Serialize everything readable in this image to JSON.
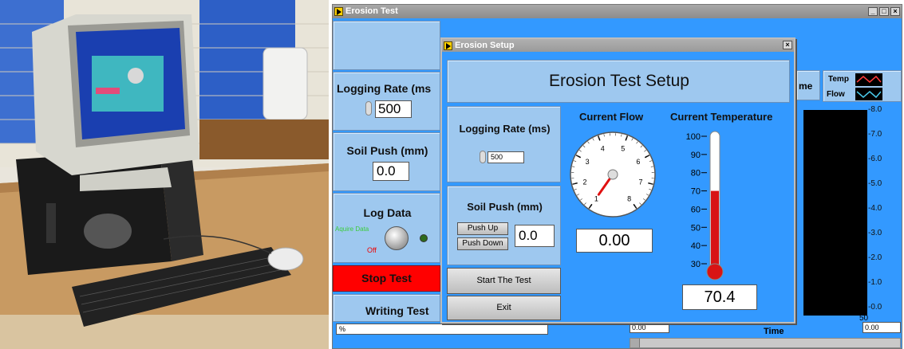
{
  "main_window": {
    "title": "Erosion Test",
    "logging_rate_label": "Logging Rate (ms",
    "logging_rate_value": "500",
    "soil_push_label": "Soil Push (mm)",
    "soil_push_value": "0.0",
    "log_data_label": "Log Data",
    "acquire_label": "Aquire Data",
    "off_label": "Off",
    "stop_button": "Stop Test",
    "writing_label": "Writing Test",
    "status_path": "%",
    "time_label": "Time",
    "time_button_partial": "me",
    "legend": [
      "Temp",
      "Flow"
    ],
    "y_ticks": [
      "8.0",
      "7.0",
      "6.0",
      "5.0",
      "4.0",
      "3.0",
      "2.0",
      "1.0",
      "0.0"
    ],
    "x_tick_end": "50",
    "x_min_field": "0.00",
    "x_max_field": "0.00"
  },
  "setup_dialog": {
    "title": "Erosion Setup",
    "heading": "Erosion Test Setup",
    "logging_rate_label": "Logging Rate (ms)",
    "logging_rate_value": "500",
    "soil_push_label": "Soil Push (mm)",
    "push_up": "Push Up",
    "push_down": "Push Down",
    "soil_push_value": "0.0",
    "start_button": "Start The Test",
    "exit_button": "Exit",
    "flow_label": "Current Flow",
    "flow_value": "0.00",
    "gauge_ticks": [
      "1",
      "2",
      "3",
      "4",
      "5",
      "6",
      "7",
      "8"
    ],
    "temp_label": "Current Temperature",
    "temp_ticks": [
      "100",
      "90",
      "80",
      "70",
      "60",
      "50",
      "40",
      "30"
    ],
    "temp_value": "70.4",
    "thermometer_level": 70
  }
}
